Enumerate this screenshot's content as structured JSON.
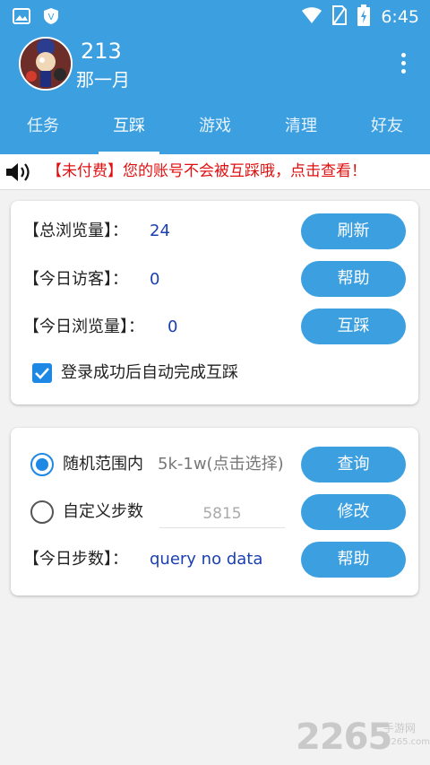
{
  "status_bar": {
    "time": "6:45"
  },
  "header": {
    "user_name": "213",
    "user_subtitle": "那一月"
  },
  "tabs": [
    {
      "label": "任务"
    },
    {
      "label": "互踩"
    },
    {
      "label": "游戏"
    },
    {
      "label": "清理"
    },
    {
      "label": "好友"
    }
  ],
  "notice": {
    "text": "【未付费】您的账号不会被互踩哦，点击查看！"
  },
  "stats": {
    "total_views_label": "【总浏览量】：",
    "total_views_value": "24",
    "today_visitors_label": "【今日访客】：",
    "today_visitors_value": "0",
    "today_views_label": "【今日浏览量】：",
    "today_views_value": "0",
    "refresh_button": "刷新",
    "help_button": "帮助",
    "mutual_button": "互踩",
    "auto_complete_label": "登录成功后自动完成互踩",
    "auto_complete_checked": true
  },
  "steps": {
    "random_label": "随机范围内",
    "random_hint": "5k-1w(点击选择)",
    "random_selected": true,
    "custom_label": "自定义步数",
    "custom_placeholder": "5815",
    "today_steps_label": "【今日步数】：",
    "today_steps_value": "query no data",
    "query_button": "查询",
    "modify_button": "修改",
    "help_button": "帮助"
  },
  "watermark": {
    "digits": "2265",
    "site_cn": "手游网",
    "site_url": "2265.com"
  },
  "colors": {
    "primary": "#3b9fe0",
    "notice_red": "#e01010",
    "value_blue": "#1a3fb0",
    "check_blue": "#1e88e5"
  },
  "icons": {
    "status_left": [
      "image-icon",
      "shield-icon"
    ],
    "status_right": [
      "wifi-icon",
      "no-sim-icon",
      "battery-icon"
    ],
    "notice": "speaker-icon",
    "menu": "more-vertical-icon"
  }
}
